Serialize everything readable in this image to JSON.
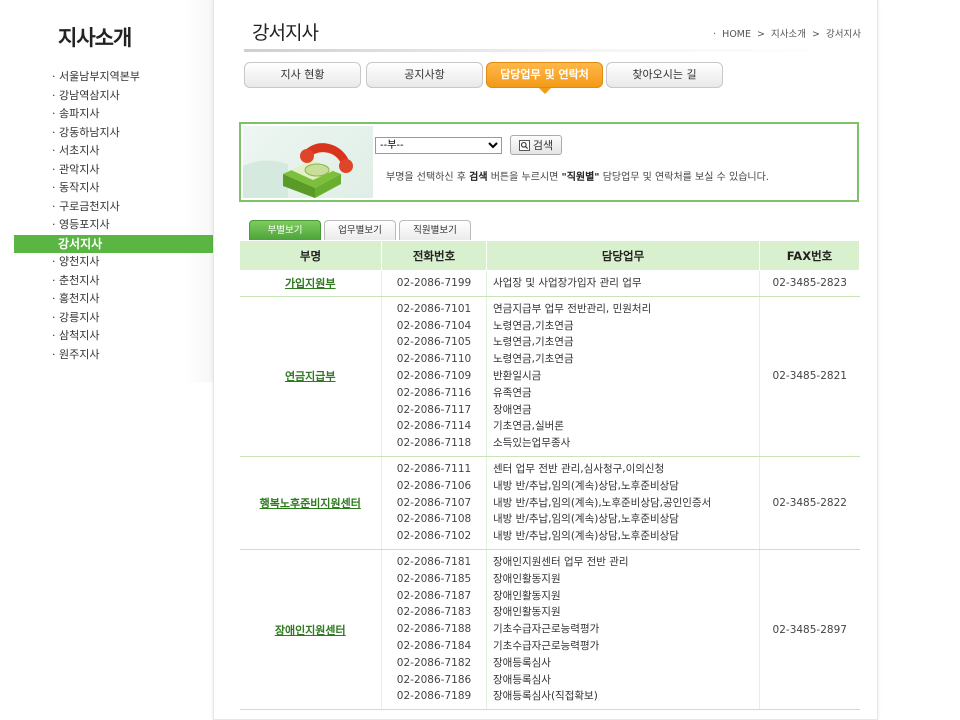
{
  "sidebar": {
    "title": "지사소개",
    "items": [
      {
        "label": "서울남부지역본부",
        "active": false
      },
      {
        "label": "강남역삼지사",
        "active": false
      },
      {
        "label": "송파지사",
        "active": false
      },
      {
        "label": "강동하남지사",
        "active": false
      },
      {
        "label": "서초지사",
        "active": false
      },
      {
        "label": "관악지사",
        "active": false
      },
      {
        "label": "동작지사",
        "active": false
      },
      {
        "label": "구로금천지사",
        "active": false
      },
      {
        "label": "영등포지사",
        "active": false
      },
      {
        "label": "강서지사",
        "active": true
      },
      {
        "label": "양천지사",
        "active": false
      },
      {
        "label": "춘천지사",
        "active": false
      },
      {
        "label": "홍천지사",
        "active": false
      },
      {
        "label": "강릉지사",
        "active": false
      },
      {
        "label": "삼척지사",
        "active": false
      },
      {
        "label": "원주지사",
        "active": false
      }
    ]
  },
  "header": {
    "title": "강서지사",
    "breadcrumb": [
      "HOME",
      "지사소개",
      "강서지사"
    ],
    "breadcrumb_prefix": "·",
    "breadcrumb_sep": ">"
  },
  "tabs": [
    {
      "label": "지사 현황",
      "active": false
    },
    {
      "label": "공지사항",
      "active": false
    },
    {
      "label": "담당업무 및 연락처",
      "active": true
    },
    {
      "label": "찾아오시는 길",
      "active": false
    }
  ],
  "search": {
    "select_value": "--부--",
    "button_label": "검색",
    "instruction_parts": [
      "부명을 선택하신 후 ",
      "검색",
      " 버튼을 누르시면 ",
      "\"직원별\"",
      " 담당업무 및 연락처를 보실 수 있습니다."
    ]
  },
  "subtabs": [
    {
      "label": "부별보기",
      "active": true
    },
    {
      "label": "업무별보기",
      "active": false
    },
    {
      "label": "직원별보기",
      "active": false
    }
  ],
  "table": {
    "headers": [
      "부명",
      "전화번호",
      "담당업무",
      "FAX번호"
    ],
    "rows": [
      {
        "dept": "가입지원부",
        "phones": [
          "02-2086-7199"
        ],
        "duties": [
          "사업장 및 사업장가입자 관리 업무"
        ],
        "fax": "02-3485-2823"
      },
      {
        "dept": "연금지급부",
        "phones": [
          "02-2086-7101",
          "02-2086-7104",
          "02-2086-7105",
          "02-2086-7110",
          "02-2086-7109",
          "02-2086-7116",
          "02-2086-7117",
          "02-2086-7114",
          "02-2086-7118"
        ],
        "duties": [
          "연금지급부 업무 전반관리, 민원처리",
          "노령연금,기초연금",
          "노령연금,기초연금",
          "노령연금,기초연금",
          "반환일시금",
          "유족연금",
          "장애연금",
          "기초연금,실버론",
          "소득있는업무종사"
        ],
        "fax": "02-3485-2821"
      },
      {
        "dept": "행복노후준비지원센터",
        "phones": [
          "02-2086-7111",
          "02-2086-7106",
          "02-2086-7107",
          "02-2086-7108",
          "02-2086-7102"
        ],
        "duties": [
          "센터 업무 전반 관리,심사청구,이의신청",
          "내방 반/추납,임의(계속)상담,노후준비상담",
          "내방 반/추납,임의(계속),노후준비상담,공인인증서",
          "내방 반/추납,임의(계속)상담,노후준비상담",
          "내방 반/추납,임의(계속)상담,노후준비상담"
        ],
        "fax": "02-3485-2822"
      },
      {
        "dept": "장애인지원센터",
        "phones": [
          "02-2086-7181",
          "02-2086-7185",
          "02-2086-7187",
          "02-2086-7183",
          "02-2086-7188",
          "02-2086-7184",
          "02-2086-7182",
          "02-2086-7186",
          "02-2086-7189"
        ],
        "duties": [
          "장애인지원센터 업무 전반 관리",
          "장애인활동지원",
          "장애인활동지원",
          "장애인활동지원",
          "기초수급자근로능력평가",
          "기초수급자근로능력평가",
          "장애등록심사",
          "장애등록심사",
          "장애등록심사(직접확보)"
        ],
        "fax": "02-3485-2897"
      }
    ]
  },
  "colors": {
    "accent_green": "#5ab543",
    "tab_orange": "#f39a17",
    "table_header_bg": "#d9f0cf",
    "dept_link": "#2e7a1f"
  }
}
